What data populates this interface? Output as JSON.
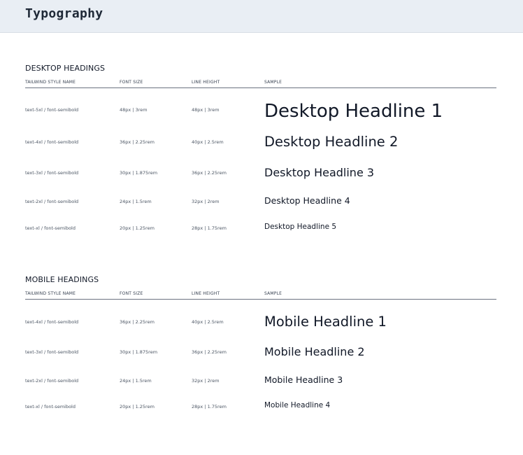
{
  "header": {
    "title": "Typography"
  },
  "columns": {
    "style_name": "TAILWIND STYLE NAME",
    "font_size": "FONT SIZE",
    "line_height": "LINE HEIGHT",
    "sample": "SAMPLE"
  },
  "desktop": {
    "title": "DESKTOP HEADINGS",
    "rows": [
      {
        "style": "text-5xl / font-semibold",
        "size": "48px | 3rem",
        "line": "48px | 3rem",
        "sample": "Desktop Headline 1"
      },
      {
        "style": "text-4xl / font-semibold",
        "size": "36px | 2.25rem",
        "line": "40px | 2.5rem",
        "sample": "Desktop Headline 2"
      },
      {
        "style": "text-3xl / font-semibold",
        "size": "30px | 1.875rem",
        "line": "36px | 2.25rem",
        "sample": "Desktop Headline 3"
      },
      {
        "style": "text-2xl / font-semibold",
        "size": "24px | 1.5rem",
        "line": "32px | 2rem",
        "sample": "Desktop Headline 4"
      },
      {
        "style": "text-xl / font-semibold",
        "size": "20px | 1.25rem",
        "line": "28px | 1.75rem",
        "sample": "Desktop Headline 5"
      }
    ]
  },
  "mobile": {
    "title": "MOBILE HEADINGS",
    "rows": [
      {
        "style": "text-4xl / font-semibold",
        "size": "36px | 2.25rem",
        "line": "40px | 2.5rem",
        "sample": "Mobile Headline 1"
      },
      {
        "style": "text-3xl / font-semibold",
        "size": "30px | 1.875rem",
        "line": "36px | 2.25rem",
        "sample": "Mobile Headline 2"
      },
      {
        "style": "text-2xl / font-semibold",
        "size": "24px | 1.5rem",
        "line": "32px | 2rem",
        "sample": "Mobile Headline 3"
      },
      {
        "style": "text-xl / font-semibold",
        "size": "20px | 1.25rem",
        "line": "28px | 1.75rem",
        "sample": "Mobile Headline 4"
      }
    ]
  }
}
